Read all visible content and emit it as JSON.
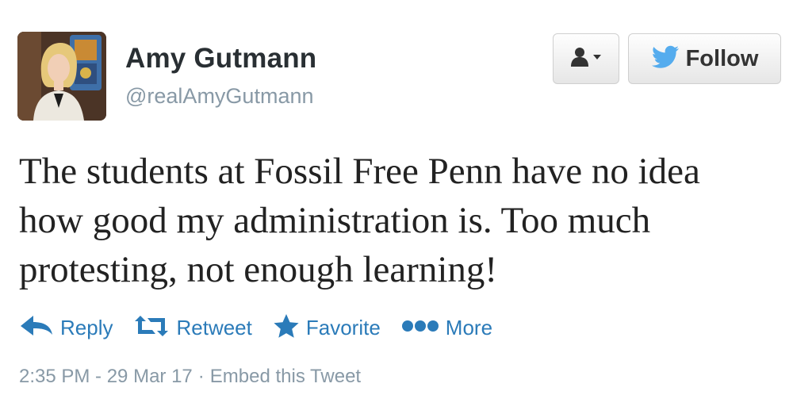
{
  "user": {
    "display_name": "Amy Gutmann",
    "handle": "@realAmyGutmann"
  },
  "header_buttons": {
    "user_dropdown_icon": "person-dropdown-icon",
    "follow_label": "Follow",
    "follow_icon": "bird-icon"
  },
  "tweet": {
    "text": "The students at Fossil Free Penn have no idea how good my administration is. Too much protesting, not enough learning!"
  },
  "actions": [
    {
      "label": "Reply",
      "icon": "reply-icon"
    },
    {
      "label": "Retweet",
      "icon": "retweet-icon"
    },
    {
      "label": "Favorite",
      "icon": "star-icon"
    },
    {
      "label": "More",
      "icon": "more-dots-icon"
    }
  ],
  "meta": {
    "timestamp": "2:35 PM - 29 Mar 17",
    "separator": "·",
    "embed_label": "Embed this Tweet"
  },
  "colors": {
    "link": "#2b7bb9",
    "name": "#292f33",
    "muted": "#8899a6",
    "bird": "#55acee"
  }
}
